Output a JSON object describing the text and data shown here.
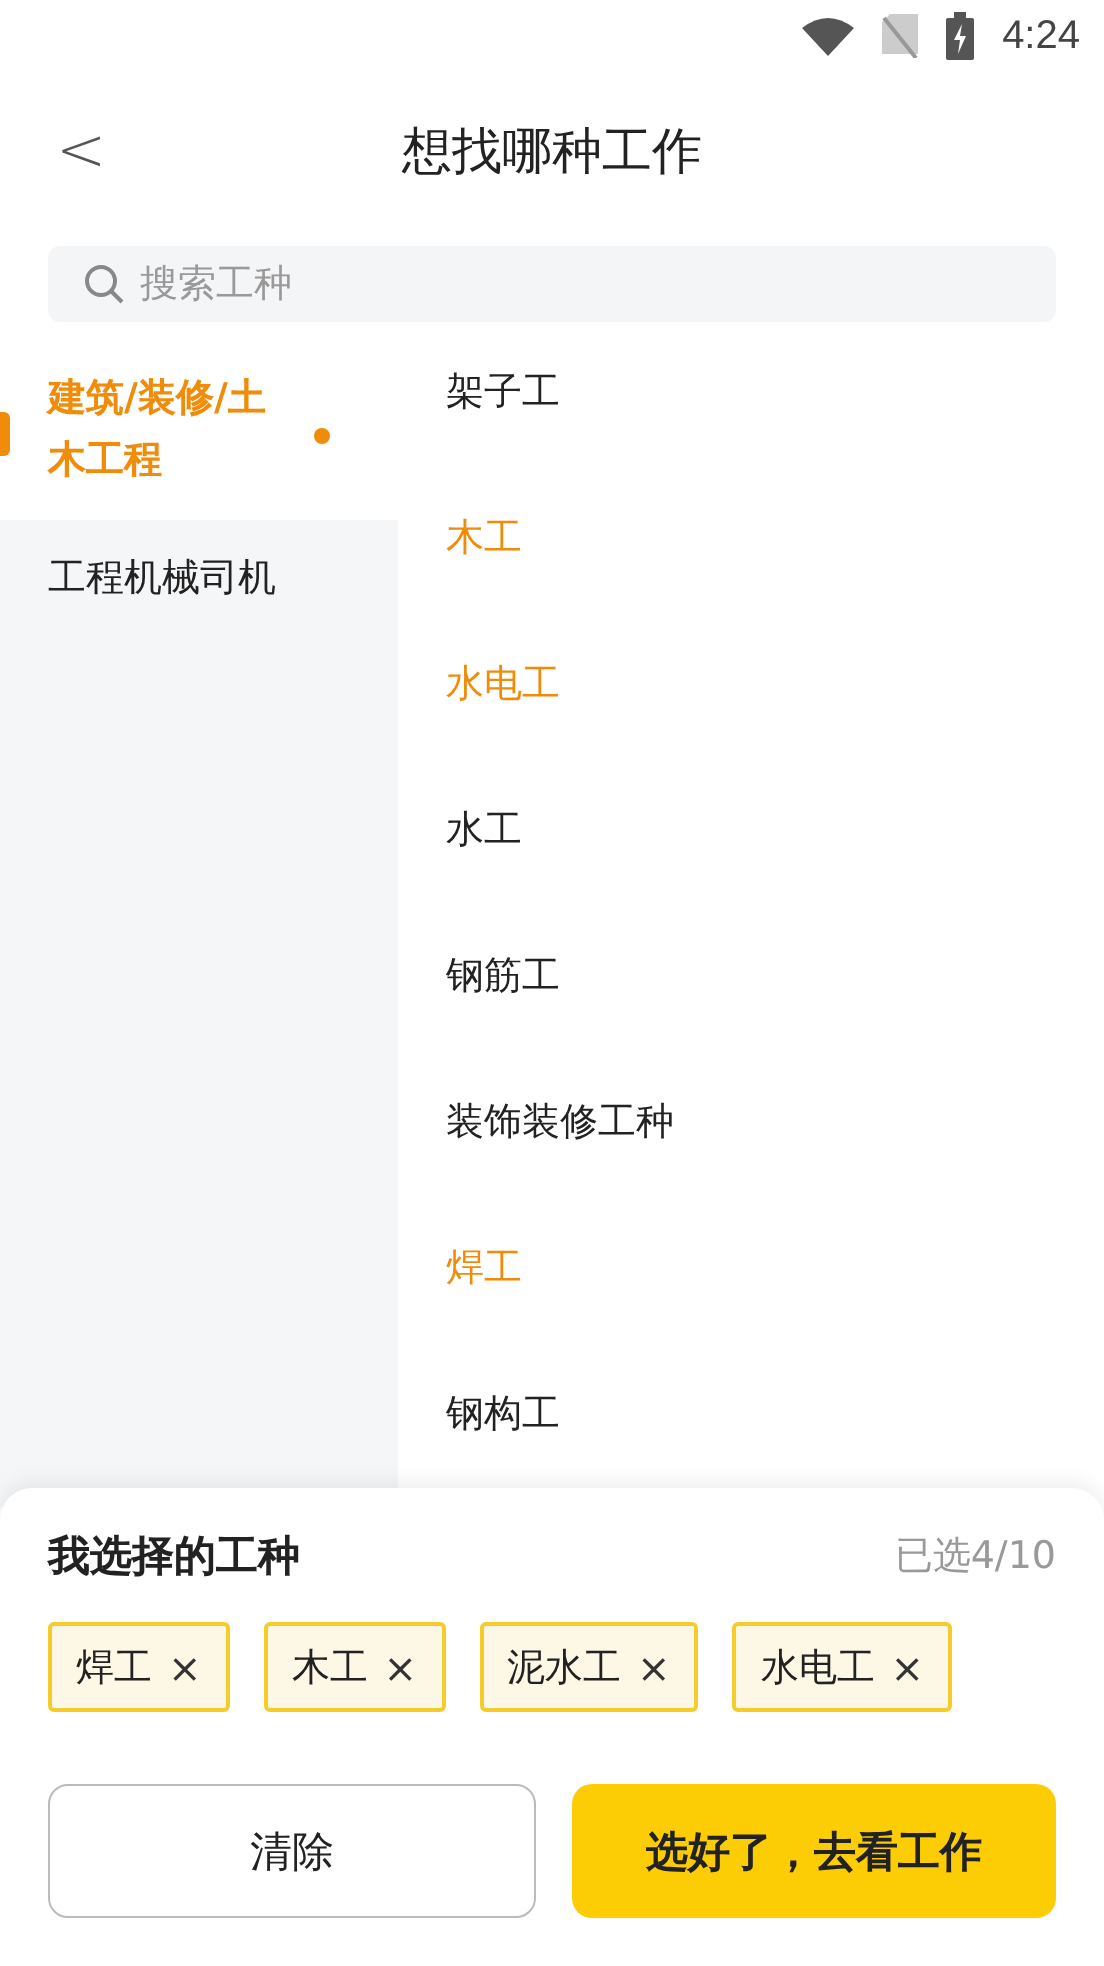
{
  "status_bar": {
    "time": "4:24"
  },
  "header": {
    "back": "<",
    "title": "想找哪种工作"
  },
  "search": {
    "placeholder": "搜索工种"
  },
  "categories": [
    {
      "label": "建筑/装修/土木工程",
      "selected": true,
      "has_picks": true
    },
    {
      "label": "工程机械司机",
      "selected": false,
      "has_picks": false
    }
  ],
  "jobs": [
    {
      "label": "架子工",
      "selected": false
    },
    {
      "label": "木工",
      "selected": true
    },
    {
      "label": "水电工",
      "selected": true
    },
    {
      "label": "水工",
      "selected": false
    },
    {
      "label": "钢筋工",
      "selected": false
    },
    {
      "label": "装饰装修工种",
      "selected": false
    },
    {
      "label": "焊工",
      "selected": true
    },
    {
      "label": "钢构工",
      "selected": false
    }
  ],
  "picked": {
    "title": "我选择的工种",
    "count": "已选4/10",
    "tags": [
      {
        "label": "焊工",
        "remove": "×"
      },
      {
        "label": "木工",
        "remove": "×"
      },
      {
        "label": "泥水工",
        "remove": "×"
      },
      {
        "label": "水电工",
        "remove": "×"
      }
    ]
  },
  "buttons": [
    {
      "label": "清除",
      "kind": "secondary"
    },
    {
      "label": "选好了，去看工作",
      "kind": "primary"
    }
  ]
}
